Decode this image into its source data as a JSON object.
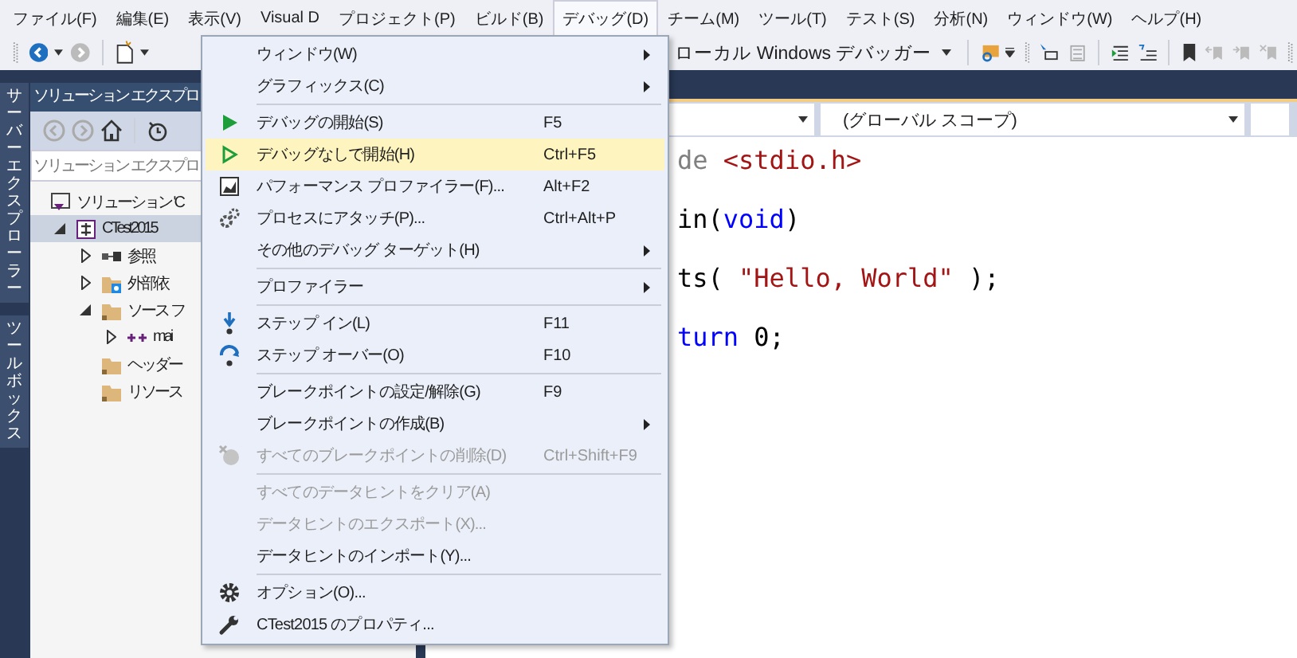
{
  "menubar": [
    {
      "label": "ファイル(F)",
      "selected": false
    },
    {
      "label": "編集(E)",
      "selected": false
    },
    {
      "label": "表示(V)",
      "selected": false
    },
    {
      "label": "Visual D",
      "selected": false
    },
    {
      "label": "プロジェクト(P)",
      "selected": false
    },
    {
      "label": "ビルド(B)",
      "selected": false
    },
    {
      "label": "デバッグ(D)",
      "selected": true
    },
    {
      "label": "チーム(M)",
      "selected": false
    },
    {
      "label": "ツール(T)",
      "selected": false
    },
    {
      "label": "テスト(S)",
      "selected": false
    },
    {
      "label": "分析(N)",
      "selected": false
    },
    {
      "label": "ウィンドウ(W)",
      "selected": false
    },
    {
      "label": "ヘルプ(H)",
      "selected": false
    }
  ],
  "toolbar": {
    "debugger_target": "ローカル Windows デバッガー"
  },
  "side_tabs": [
    "サーバーエクスプローラー",
    "ツールボックス"
  ],
  "solution_explorer": {
    "title": "ソリューション エクスプロ",
    "search": {
      "placeholder": "ソリューション エクスプロ"
    },
    "tree": [
      {
        "kind": "solution",
        "label": "ソリューション 'C",
        "selected": false,
        "children": [
          {
            "kind": "project",
            "label": "CTest2015",
            "selected": true,
            "expanded": true,
            "children": [
              {
                "kind": "references",
                "label": "参照",
                "selected": false,
                "expanded": false
              },
              {
                "kind": "external",
                "label": "外部依",
                "selected": false,
                "expanded": false
              },
              {
                "kind": "folder",
                "label": "ソース フ",
                "selected": false,
                "expanded": true,
                "children": [
                  {
                    "kind": "file",
                    "label": "mai",
                    "selected": false,
                    "expanded": false
                  }
                ]
              },
              {
                "kind": "folder",
                "label": "ヘッダー",
                "selected": false
              },
              {
                "kind": "folder",
                "label": "リソース",
                "selected": false
              }
            ]
          }
        ]
      }
    ]
  },
  "editor": {
    "scope": "(グローバル スコープ)",
    "code_lines": [
      {
        "tokens": [
          {
            "kind": "preproc",
            "text": "de "
          },
          {
            "kind": "string",
            "text": "<stdio.h>"
          }
        ]
      },
      {
        "tokens": [
          {
            "kind": "plain",
            "text": "in("
          },
          {
            "kind": "keyword",
            "text": "void"
          },
          {
            "kind": "plain",
            "text": ")"
          }
        ]
      },
      {
        "tokens": [
          {
            "kind": "plain",
            "text": "ts( "
          },
          {
            "kind": "string",
            "text": "\"Hello, World\""
          },
          {
            "kind": "plain",
            "text": " );"
          }
        ]
      },
      {
        "tokens": [
          {
            "kind": "keyword",
            "text": "turn"
          },
          {
            "kind": "plain",
            "text": " 0;"
          }
        ]
      }
    ]
  },
  "debug_menu": {
    "items": [
      {
        "kind": "item",
        "label": "ウィンドウ(W)",
        "submenu": true,
        "disabled": false,
        "selected": false
      },
      {
        "kind": "item",
        "label": "グラフィックス(C)",
        "submenu": true,
        "disabled": false,
        "selected": false
      },
      {
        "kind": "separator"
      },
      {
        "kind": "item",
        "label": "デバッグの開始(S)",
        "shortcut": "F5",
        "disabled": false,
        "selected": false
      },
      {
        "kind": "item",
        "label": "デバッグなしで開始(H)",
        "shortcut": "Ctrl+F5",
        "disabled": false,
        "selected": true
      },
      {
        "kind": "item",
        "label": "パフォーマンス プロファイラー(F)...",
        "shortcut": "Alt+F2",
        "disabled": false,
        "selected": false
      },
      {
        "kind": "item",
        "label": "プロセスにアタッチ(P)...",
        "shortcut": "Ctrl+Alt+P",
        "disabled": false,
        "selected": false
      },
      {
        "kind": "item",
        "label": "その他のデバッグ ターゲット(H)",
        "submenu": true,
        "disabled": false,
        "selected": false
      },
      {
        "kind": "separator"
      },
      {
        "kind": "item",
        "label": "プロファイラー",
        "submenu": true,
        "disabled": false,
        "selected": false
      },
      {
        "kind": "separator"
      },
      {
        "kind": "item",
        "label": "ステップ イン(L)",
        "shortcut": "F11",
        "disabled": false,
        "selected": false
      },
      {
        "kind": "item",
        "label": "ステップ オーバー(O)",
        "shortcut": "F10",
        "disabled": false,
        "selected": false
      },
      {
        "kind": "separator"
      },
      {
        "kind": "item",
        "label": "ブレークポイントの設定/解除(G)",
        "shortcut": "F9",
        "disabled": false,
        "selected": false
      },
      {
        "kind": "item",
        "label": "ブレークポイントの作成(B)",
        "submenu": true,
        "disabled": false,
        "selected": false
      },
      {
        "kind": "item",
        "label": "すべてのブレークポイントの削除(D)",
        "shortcut": "Ctrl+Shift+F9",
        "disabled": true,
        "selected": false
      },
      {
        "kind": "separator"
      },
      {
        "kind": "item",
        "label": "すべてのデータヒントをクリア(A)",
        "disabled": true,
        "selected": false
      },
      {
        "kind": "item",
        "label": "データヒントのエクスポート(X)...",
        "disabled": true,
        "selected": false
      },
      {
        "kind": "item",
        "label": "データヒントのインポート(Y)...",
        "disabled": false,
        "selected": false
      },
      {
        "kind": "separator"
      },
      {
        "kind": "item",
        "label": "オプション(O)...",
        "disabled": false,
        "selected": false
      },
      {
        "kind": "item",
        "label": "CTest2015 のプロパティ...",
        "disabled": false,
        "selected": false
      }
    ]
  }
}
